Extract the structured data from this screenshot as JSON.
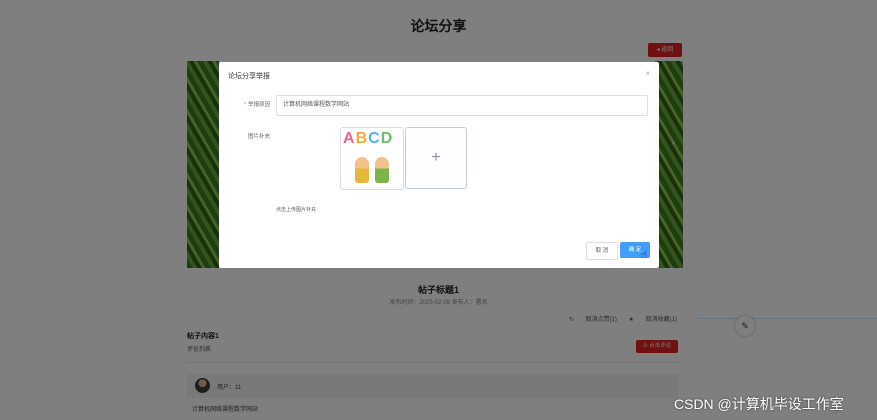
{
  "page": {
    "title": "论坛分享",
    "back_label": "◂ 返回"
  },
  "post": {
    "title": "帖子标题1",
    "meta": "发布时间：2025-02-09    发布人：署名",
    "actions": [
      "取消点赞(1)",
      "取消收藏(1)"
    ],
    "content_label": "帖子内容1",
    "comments_label": "评论列表",
    "comment_button": "点击评论",
    "comment_user": "用户：11",
    "comment_text": "计算机网络课程数学网站"
  },
  "modal": {
    "title": "论坛分享举报",
    "close": "×",
    "title_label": "举报原因",
    "title_value": "计算机网络课程数学网站",
    "image_label": "图片补充",
    "thumb_letters": "ABCD",
    "upload_plus": "+",
    "upload_hint": "点击上传图片补充",
    "cancel_label": "取 消",
    "ok_label": "确 定"
  },
  "watermark": "CSDN @计算机毕设工作室"
}
